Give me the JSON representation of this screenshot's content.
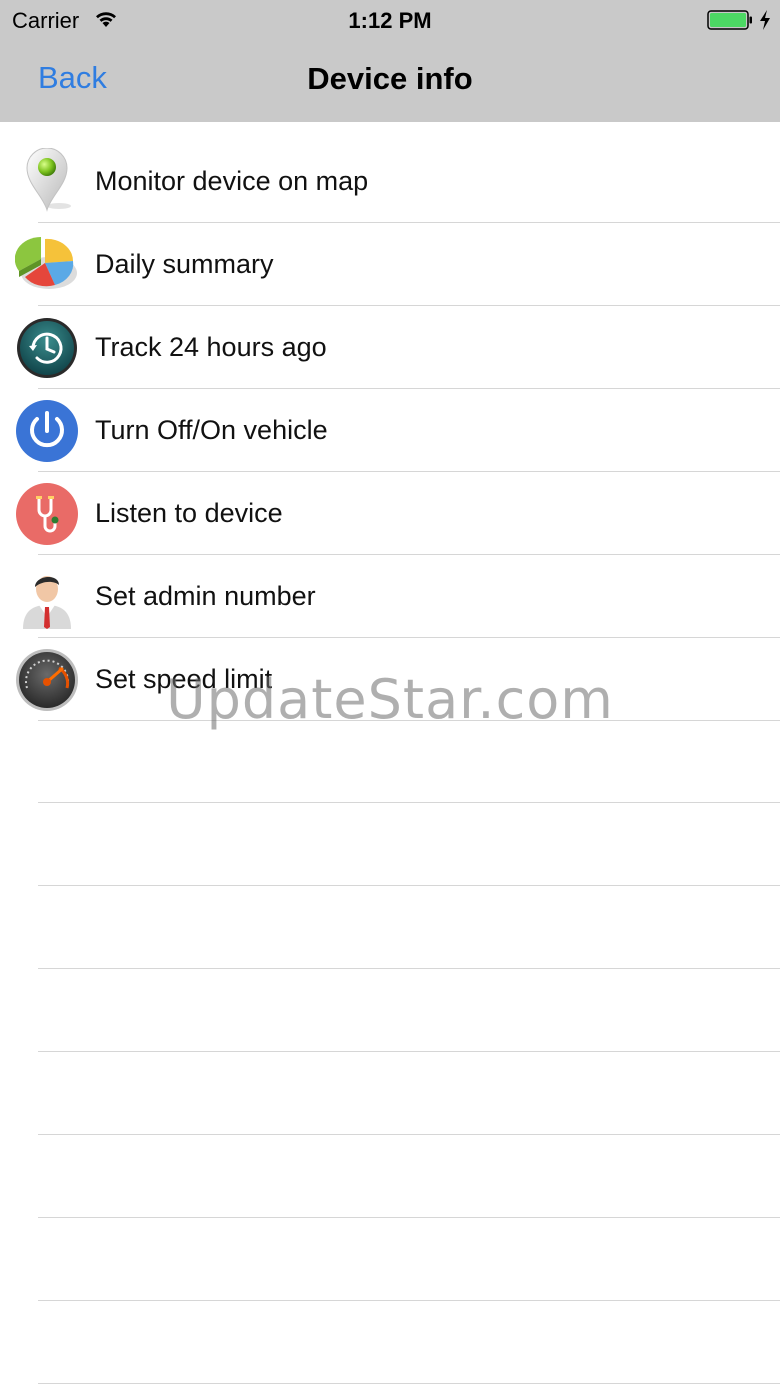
{
  "status_bar": {
    "carrier": "Carrier",
    "time": "1:12 PM",
    "battery_icon": "battery-charging-icon",
    "wifi_icon": "wifi-icon"
  },
  "nav": {
    "back_label": "Back",
    "title": "Device info"
  },
  "menu": {
    "items": [
      {
        "label": "Monitor device on map",
        "icon": "map-pin-icon"
      },
      {
        "label": "Daily summary",
        "icon": "pie-chart-icon"
      },
      {
        "label": "Track 24 hours ago",
        "icon": "history-clock-icon"
      },
      {
        "label": "Turn Off/On vehicle",
        "icon": "power-icon"
      },
      {
        "label": "Listen to device",
        "icon": "stethoscope-icon"
      },
      {
        "label": "Set admin number",
        "icon": "admin-user-icon"
      },
      {
        "label": "Set speed limit",
        "icon": "speedometer-icon"
      }
    ]
  },
  "watermark": "UpdateStar.com",
  "colors": {
    "nav_bg": "#c9c9c9",
    "accent": "#2f7de1",
    "battery": "#4cd964",
    "separator": "#d6d6d6"
  }
}
